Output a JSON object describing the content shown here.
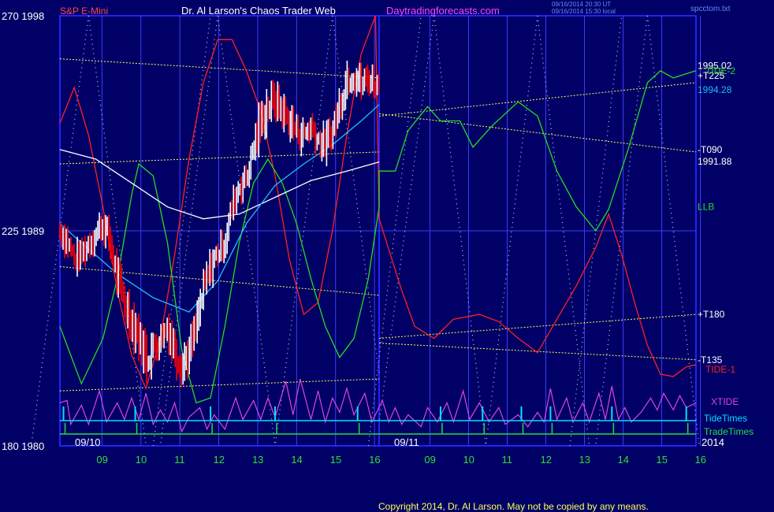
{
  "header": {
    "symbol": "S&P E-Mini",
    "title": "Dr. Al Larson's Chaos Trader Web",
    "site": "Daytradingforecasts.com",
    "stamp1": "09/16/2014 20:30 UT",
    "stamp2": "09/16/2014 15:30 local",
    "file": "spcctom.txt"
  },
  "footer": {
    "copyright": "Copyright 2014, Dr. Al Larson. May not be copied by any means."
  },
  "colors": {
    "background": "#000066",
    "frame": "#2222ff",
    "grid": "#3c3cff",
    "price_up": "#ffffff",
    "price_down": "#ff0000",
    "tide1": "#ff2020",
    "tide2": "#22dd22",
    "xtide": "#dd44dd",
    "tidetimes": "#00e0ff",
    "tradetimes": "#22dd44",
    "channel": "#ffff55",
    "ma_white": "#ffffff",
    "ma_cyan": "#22bbff"
  },
  "chart_data": {
    "type": "line",
    "y_left_labels": [
      {
        "v": 1998,
        "txt": "270  1998"
      },
      {
        "v": 1989,
        "txt": "225  1989"
      },
      {
        "v": 1980,
        "txt": "180  1980"
      }
    ],
    "ylim": [
      1980,
      1998
    ],
    "xlim": [
      8.0,
      16.0
    ],
    "x_ticks_left": [
      "09",
      "10",
      "11",
      "12",
      "13",
      "14",
      "15",
      "16"
    ],
    "x_ticks_right": [
      "09",
      "10",
      "11",
      "12",
      "13",
      "14",
      "15",
      "16"
    ],
    "date_labels": [
      "09/10",
      "09/11",
      "2014"
    ],
    "right_labels": [
      {
        "text": "1995.02",
        "color": "#ffffff",
        "v": 1995.9
      },
      {
        "text": "+T225",
        "color": "#ffffff",
        "v": 1995.5
      },
      {
        "text": "TIDE-2",
        "color": "#22dd22",
        "v": 1995.7
      },
      {
        "text": "1994.28",
        "color": "#22bbff",
        "v": 1994.9
      },
      {
        "text": "-T090",
        "color": "#ffffff",
        "v": 1992.4
      },
      {
        "text": "1991.88",
        "color": "#ffffff",
        "v": 1991.9
      },
      {
        "text": "LLB",
        "color": "#22dd22",
        "v": 1990.0
      },
      {
        "text": "+T180",
        "color": "#ffffff",
        "v": 1985.5
      },
      {
        "text": "-T135",
        "color": "#ffffff",
        "v": 1983.6
      },
      {
        "text": "TIDE-1",
        "color": "#ff2020",
        "v": 1983.2
      }
    ],
    "bottom_labels": [
      {
        "text": "XTIDE",
        "color": "#dd44dd"
      },
      {
        "text": "TideTimes",
        "color": "#00e0ff"
      },
      {
        "text": "TradeTimes",
        "color": "#22dd44"
      }
    ],
    "price_close": [
      [
        8.0,
        1989.0
      ],
      [
        8.1,
        1988.6
      ],
      [
        8.2,
        1987.8
      ],
      [
        8.3,
        1988.0
      ],
      [
        8.4,
        1988.5
      ],
      [
        8.5,
        1988.9
      ],
      [
        8.6,
        1989.3
      ],
      [
        8.7,
        1988.5
      ],
      [
        8.8,
        1987.0
      ],
      [
        8.9,
        1986.0
      ],
      [
        9.0,
        1985.2
      ],
      [
        9.1,
        1984.6
      ],
      [
        9.2,
        1983.6
      ],
      [
        9.3,
        1984.1
      ],
      [
        9.4,
        1984.5
      ],
      [
        9.5,
        1985.0
      ],
      [
        9.6,
        1984.0
      ],
      [
        9.7,
        1983.4
      ],
      [
        9.8,
        1983.9
      ],
      [
        9.9,
        1985.0
      ],
      [
        10.0,
        1986.5
      ],
      [
        10.1,
        1987.5
      ],
      [
        10.2,
        1988.1
      ],
      [
        10.3,
        1988.6
      ],
      [
        10.4,
        1990.0
      ],
      [
        10.5,
        1990.9
      ],
      [
        10.6,
        1991.2
      ],
      [
        10.7,
        1992.5
      ],
      [
        10.8,
        1993.6
      ],
      [
        10.9,
        1994.2
      ],
      [
        11.0,
        1994.5
      ],
      [
        11.1,
        1994.0
      ],
      [
        11.2,
        1993.6
      ],
      [
        11.3,
        1993.2
      ],
      [
        11.4,
        1993.0
      ],
      [
        11.5,
        1993.4
      ],
      [
        11.6,
        1992.8
      ],
      [
        11.7,
        1992.6
      ],
      [
        11.8,
        1993.2
      ],
      [
        11.9,
        1994.3
      ],
      [
        12.0,
        1995.4
      ],
      [
        12.1,
        1995.6
      ],
      [
        12.2,
        1995.1
      ],
      [
        12.3,
        1995.4
      ],
      [
        12.4,
        1995.2
      ],
      [
        12.45,
        1995.02
      ]
    ],
    "price_spread": [
      [
        8.0,
        0.9
      ],
      [
        8.1,
        0.9
      ],
      [
        8.2,
        0.8
      ],
      [
        8.3,
        0.8
      ],
      [
        8.4,
        0.8
      ],
      [
        8.5,
        0.8
      ],
      [
        8.6,
        1.1
      ],
      [
        8.7,
        1.1
      ],
      [
        8.8,
        1.2
      ],
      [
        8.9,
        1.3
      ],
      [
        9.0,
        1.3
      ],
      [
        9.1,
        1.4
      ],
      [
        9.2,
        1.5
      ],
      [
        9.3,
        1.3
      ],
      [
        9.4,
        1.2
      ],
      [
        9.5,
        1.1
      ],
      [
        9.6,
        1.3
      ],
      [
        9.7,
        1.3
      ],
      [
        9.8,
        1.2
      ],
      [
        9.9,
        1.1
      ],
      [
        10.0,
        1.1
      ],
      [
        10.1,
        1.0
      ],
      [
        10.2,
        0.8
      ],
      [
        10.3,
        0.8
      ],
      [
        10.4,
        0.9
      ],
      [
        10.5,
        1.0
      ],
      [
        10.6,
        1.0
      ],
      [
        10.7,
        1.2
      ],
      [
        10.8,
        1.3
      ],
      [
        10.9,
        1.3
      ],
      [
        11.0,
        1.2
      ],
      [
        11.1,
        1.1
      ],
      [
        11.2,
        1.0
      ],
      [
        11.3,
        1.0
      ],
      [
        11.4,
        1.0
      ],
      [
        11.5,
        1.0
      ],
      [
        11.6,
        1.0
      ],
      [
        11.7,
        1.0
      ],
      [
        11.8,
        1.1
      ],
      [
        11.9,
        1.2
      ],
      [
        12.0,
        1.2
      ],
      [
        12.1,
        1.1
      ],
      [
        12.2,
        1.0
      ],
      [
        12.3,
        1.0
      ],
      [
        12.4,
        0.8
      ],
      [
        12.45,
        0.7
      ]
    ],
    "ma_white": [
      [
        8.0,
        1992.4
      ],
      [
        8.5,
        1992.0
      ],
      [
        9.0,
        1991.0
      ],
      [
        9.5,
        1990.0
      ],
      [
        10.0,
        1989.5
      ],
      [
        10.5,
        1989.7
      ],
      [
        11.0,
        1990.4
      ],
      [
        11.5,
        1991.1
      ],
      [
        12.0,
        1991.5
      ],
      [
        12.45,
        1991.88
      ]
    ],
    "ma_cyan": [
      [
        8.0,
        1989.3
      ],
      [
        8.3,
        1988.5
      ],
      [
        8.8,
        1987.2
      ],
      [
        9.3,
        1986.2
      ],
      [
        9.8,
        1985.6
      ],
      [
        10.2,
        1986.9
      ],
      [
        10.6,
        1989.3
      ],
      [
        11.0,
        1990.9
      ],
      [
        11.4,
        1991.8
      ],
      [
        11.8,
        1992.6
      ],
      [
        12.2,
        1993.6
      ],
      [
        12.45,
        1994.28
      ]
    ],
    "tide1": [
      [
        8.0,
        1993.5
      ],
      [
        8.2,
        1995.0
      ],
      [
        8.4,
        1993.0
      ],
      [
        8.6,
        1990.0
      ],
      [
        8.8,
        1986.5
      ],
      [
        9.0,
        1983.8
      ],
      [
        9.2,
        1982.4
      ],
      [
        9.4,
        1984.5
      ],
      [
        9.6,
        1988.0
      ],
      [
        9.8,
        1992.0
      ],
      [
        10.0,
        1995.2
      ],
      [
        10.2,
        1997.0
      ],
      [
        10.4,
        1997.0
      ],
      [
        10.6,
        1995.7
      ],
      [
        10.8,
        1994.0
      ],
      [
        11.0,
        1991.3
      ],
      [
        11.2,
        1987.8
      ],
      [
        11.4,
        1985.5
      ],
      [
        11.6,
        1986.0
      ],
      [
        11.8,
        1989.0
      ],
      [
        12.0,
        1993.0
      ],
      [
        12.2,
        1996.4
      ],
      [
        12.4,
        1998.0
      ],
      [
        12.45,
        1989.5
      ],
      [
        12.8,
        1986.5
      ],
      [
        13.0,
        1985.0
      ],
      [
        13.3,
        1984.5
      ],
      [
        13.6,
        1985.3
      ],
      [
        14.0,
        1985.5
      ],
      [
        14.3,
        1985.2
      ],
      [
        14.6,
        1984.5
      ],
      [
        14.9,
        1983.9
      ],
      [
        15.2,
        1985.3
      ],
      [
        15.5,
        1986.7
      ],
      [
        15.8,
        1988.3
      ],
      [
        16.0,
        1989.7
      ],
      [
        16.2,
        1988.0
      ],
      [
        16.4,
        1986.0
      ],
      [
        16.6,
        1984.2
      ],
      [
        16.8,
        1983.0
      ],
      [
        17.0,
        1982.9
      ],
      [
        17.2,
        1983.3
      ],
      [
        17.35,
        1983.4
      ]
    ],
    "tide2": [
      [
        8.0,
        1985.0
      ],
      [
        8.3,
        1982.6
      ],
      [
        8.6,
        1984.5
      ],
      [
        8.8,
        1987.0
      ],
      [
        9.0,
        1990.5
      ],
      [
        9.1,
        1991.8
      ],
      [
        9.3,
        1991.3
      ],
      [
        9.5,
        1988.5
      ],
      [
        9.7,
        1984.0
      ],
      [
        9.9,
        1981.8
      ],
      [
        10.1,
        1982.0
      ],
      [
        10.3,
        1985.0
      ],
      [
        10.5,
        1988.5
      ],
      [
        10.7,
        1991.0
      ],
      [
        10.9,
        1992.0
      ],
      [
        11.1,
        1991.0
      ],
      [
        11.3,
        1989.3
      ],
      [
        11.5,
        1987.0
      ],
      [
        11.7,
        1985.0
      ],
      [
        11.9,
        1983.7
      ],
      [
        12.1,
        1984.5
      ],
      [
        12.3,
        1987.0
      ],
      [
        12.45,
        1990.0
      ],
      [
        12.45,
        1991.5
      ],
      [
        12.7,
        1991.5
      ],
      [
        12.9,
        1993.2
      ],
      [
        13.2,
        1994.2
      ],
      [
        13.4,
        1993.6
      ],
      [
        13.7,
        1993.6
      ],
      [
        13.9,
        1992.5
      ],
      [
        14.2,
        1993.4
      ],
      [
        14.6,
        1994.4
      ],
      [
        14.9,
        1993.8
      ],
      [
        15.2,
        1991.5
      ],
      [
        15.5,
        1990.0
      ],
      [
        15.8,
        1989.0
      ],
      [
        16.0,
        1989.9
      ],
      [
        16.3,
        1992.4
      ],
      [
        16.6,
        1995.2
      ],
      [
        16.8,
        1995.7
      ],
      [
        17.0,
        1995.4
      ],
      [
        17.35,
        1995.7
      ]
    ],
    "channel_lines": [
      [
        [
          8.0,
          1996.2
        ],
        [
          12.45,
          1995.4
        ]
      ],
      [
        [
          8.0,
          1991.8
        ],
        [
          12.45,
          1992.3
        ]
      ],
      [
        [
          8.0,
          1987.5
        ],
        [
          12.45,
          1986.3
        ]
      ],
      [
        [
          8.0,
          1982.3
        ],
        [
          12.45,
          1982.8
        ]
      ],
      [
        [
          12.45,
          1993.8
        ],
        [
          17.35,
          1995.2
        ]
      ],
      [
        [
          12.45,
          1993.9
        ],
        [
          17.35,
          1992.3
        ]
      ],
      [
        [
          12.45,
          1984.5
        ],
        [
          17.35,
          1985.5
        ]
      ],
      [
        [
          12.45,
          1984.3
        ],
        [
          17.35,
          1983.6
        ]
      ]
    ],
    "xtide": [
      [
        8.0,
        1981.8
      ],
      [
        8.1,
        1981.9
      ],
      [
        8.15,
        1980.9
      ],
      [
        8.3,
        1981.7
      ],
      [
        8.4,
        1980.9
      ],
      [
        8.55,
        1982.3
      ],
      [
        8.65,
        1981.0
      ],
      [
        8.8,
        1981.8
      ],
      [
        8.9,
        1981.1
      ],
      [
        9.0,
        1982.0
      ],
      [
        9.1,
        1981.1
      ],
      [
        9.2,
        1982.2
      ],
      [
        9.3,
        1980.9
      ],
      [
        9.4,
        1981.5
      ],
      [
        9.5,
        1981.0
      ],
      [
        9.6,
        1981.8
      ],
      [
        9.7,
        1980.6
      ],
      [
        9.8,
        1981.2
      ],
      [
        9.95,
        1981.6
      ],
      [
        10.05,
        1980.7
      ],
      [
        10.15,
        1981.3
      ],
      [
        10.3,
        1980.7
      ],
      [
        10.45,
        1982.0
      ],
      [
        10.55,
        1981.1
      ],
      [
        10.7,
        1981.9
      ],
      [
        10.8,
        1981.1
      ],
      [
        10.9,
        1982.0
      ],
      [
        11.0,
        1981.2
      ],
      [
        11.15,
        1982.7
      ],
      [
        11.25,
        1981.3
      ],
      [
        11.35,
        1982.8
      ],
      [
        11.5,
        1981.1
      ],
      [
        11.6,
        1982.3
      ],
      [
        11.7,
        1981.0
      ],
      [
        11.8,
        1982.0
      ],
      [
        11.9,
        1981.4
      ],
      [
        12.0,
        1982.4
      ],
      [
        12.1,
        1981.3
      ],
      [
        12.25,
        1982.2
      ],
      [
        12.35,
        1981.0
      ],
      [
        12.5,
        1981.9
      ],
      [
        12.6,
        1981.0
      ],
      [
        12.7,
        1981.6
      ],
      [
        12.8,
        1980.9
      ],
      [
        12.9,
        1981.3
      ],
      [
        13.1,
        1980.8
      ],
      [
        13.2,
        1981.6
      ],
      [
        13.35,
        1981.0
      ],
      [
        13.5,
        1981.8
      ],
      [
        13.6,
        1981.0
      ],
      [
        13.75,
        1982.3
      ],
      [
        13.85,
        1981.1
      ],
      [
        14.0,
        1981.8
      ],
      [
        14.15,
        1981.0
      ],
      [
        14.3,
        1981.6
      ],
      [
        14.4,
        1980.9
      ],
      [
        14.6,
        1981.3
      ],
      [
        14.75,
        1980.8
      ],
      [
        14.9,
        1981.4
      ],
      [
        15.0,
        1981.0
      ],
      [
        15.1,
        1982.4
      ],
      [
        15.2,
        1981.1
      ],
      [
        15.35,
        1982.0
      ],
      [
        15.45,
        1981.0
      ],
      [
        15.6,
        1981.8
      ],
      [
        15.7,
        1981.0
      ],
      [
        15.85,
        1982.2
      ],
      [
        15.95,
        1981.1
      ],
      [
        16.05,
        1982.5
      ],
      [
        16.15,
        1981.1
      ],
      [
        16.25,
        1981.6
      ],
      [
        16.35,
        1981.0
      ],
      [
        16.5,
        1981.4
      ],
      [
        16.65,
        1982.0
      ],
      [
        16.75,
        1981.5
      ],
      [
        16.85,
        1982.2
      ],
      [
        17.0,
        1981.5
      ],
      [
        17.1,
        1982.1
      ],
      [
        17.2,
        1981.6
      ],
      [
        17.35,
        1981.8
      ]
    ],
    "tide_times": [
      8.05,
      9.05,
      10.1,
      11.0,
      12.15,
      13.4,
      14.05,
      14.65,
      15.1,
      16.05,
      17.2
    ],
    "x_dotted_lines": [
      [
        [
          8.4,
          1998
        ],
        [
          9.2,
          1980
        ]
      ],
      [
        [
          8.4,
          1998
        ],
        [
          7.6,
          1980
        ]
      ],
      [
        [
          10.2,
          1998
        ],
        [
          11.0,
          1980
        ]
      ],
      [
        [
          10.2,
          1998
        ],
        [
          9.4,
          1980
        ]
      ],
      [
        [
          11.8,
          1998
        ],
        [
          12.45,
          1983
        ]
      ],
      [
        [
          11.8,
          1998
        ],
        [
          11.0,
          1980
        ]
      ],
      [
        [
          13.3,
          1998
        ],
        [
          14.1,
          1980
        ]
      ],
      [
        [
          13.3,
          1998
        ],
        [
          12.45,
          1981
        ]
      ],
      [
        [
          14.9,
          1998
        ],
        [
          15.7,
          1980
        ]
      ],
      [
        [
          14.9,
          1998
        ],
        [
          14.1,
          1980
        ]
      ],
      [
        [
          16.6,
          1998
        ],
        [
          17.4,
          1980
        ]
      ],
      [
        [
          16.6,
          1998
        ],
        [
          15.8,
          1980
        ]
      ],
      [
        [
          9.3,
          1980
        ],
        [
          10.1,
          1998
        ]
      ],
      [
        [
          12.3,
          1980
        ],
        [
          13.1,
          1998
        ]
      ],
      [
        [
          15.4,
          1980
        ],
        [
          16.2,
          1998
        ]
      ]
    ]
  }
}
